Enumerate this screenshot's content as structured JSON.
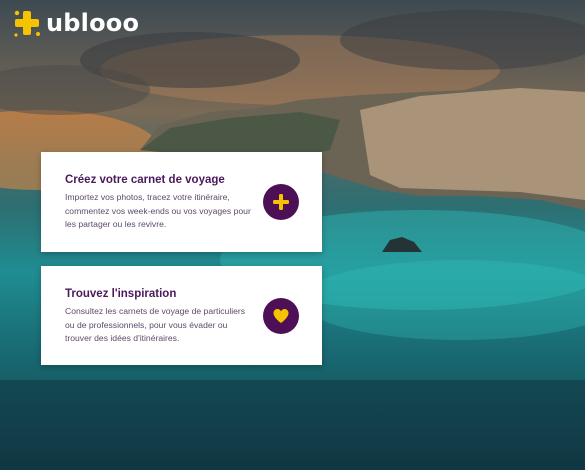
{
  "brand": {
    "name": "ublooo",
    "accent": "#f5c300",
    "primary": "#4d0f56"
  },
  "cards": [
    {
      "title": "Créez votre carnet de voyage",
      "description": "Importez vos photos, tracez votre itinéraire, commentez vos week-ends ou vos voyages pour les partager ou les revivre.",
      "action_icon": "plus-icon"
    },
    {
      "title": "Trouvez l'inspiration",
      "description": "Consultez les carnets de voyage de particuliers ou de professionnels, pour vous évader ou trouver des idées d'itinéraires.",
      "action_icon": "heart-icon"
    }
  ]
}
